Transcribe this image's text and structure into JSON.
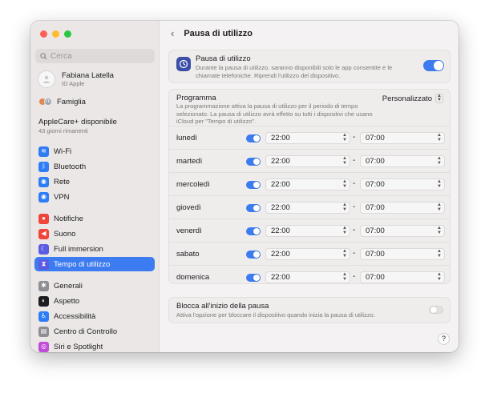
{
  "search": {
    "placeholder": "Cerca"
  },
  "profile": {
    "name": "Fabiana Latella",
    "subtitle": "ID Apple"
  },
  "family": {
    "label": "Famiglia"
  },
  "applecare": {
    "title": "AppleCare+ disponibile",
    "subtitle": "43 giorni rimanenti"
  },
  "sidebar": {
    "items": [
      {
        "label": "Wi-Fi",
        "icon": "wifi-icon",
        "color": "#2f7df6",
        "active": false
      },
      {
        "label": "Bluetooth",
        "icon": "bluetooth-icon",
        "color": "#2f7df6",
        "active": false
      },
      {
        "label": "Rete",
        "icon": "globe-icon",
        "color": "#2f7df6",
        "active": false
      },
      {
        "label": "VPN",
        "icon": "vpn-globe-icon",
        "color": "#2f7df6",
        "active": false
      },
      {
        "label": "Notifiche",
        "icon": "bell-icon",
        "color": "#f0453a",
        "active": false
      },
      {
        "label": "Suono",
        "icon": "speaker-icon",
        "color": "#f0453a",
        "active": false
      },
      {
        "label": "Full immersion",
        "icon": "moon-icon",
        "color": "#5b5ce2",
        "active": false
      },
      {
        "label": "Tempo di utilizzo",
        "icon": "hourglass-icon",
        "color": "#5b5ce2",
        "active": true
      },
      {
        "label": "Generali",
        "icon": "gear-icon",
        "color": "#8e8e93",
        "active": false
      },
      {
        "label": "Aspetto",
        "icon": "appearance-icon",
        "color": "#1d1d1f",
        "active": false
      },
      {
        "label": "Accessibilità",
        "icon": "accessibility-icon",
        "color": "#2f7df6",
        "active": false
      },
      {
        "label": "Centro di Controllo",
        "icon": "control-center-icon",
        "color": "#8e8e93",
        "active": false
      },
      {
        "label": "Siri e Spotlight",
        "icon": "siri-icon",
        "color": "#c04bd6",
        "active": false
      }
    ]
  },
  "header": {
    "title": "Pausa di utilizzo"
  },
  "downtime": {
    "title": "Pausa di utilizzo",
    "description": "Durante la pausa di utilizzo, saranno disponibili solo le app consentite e le chiamate telefoniche. Riprendi l'utilizzo del dispositivo.",
    "enabled": true
  },
  "schedule": {
    "title": "Programma",
    "description": "La programmazione attiva la pausa di utilizzo per il periodo di tempo selezionato. La pausa di utilizzo avrà effetto su tutti i dispositivi che usano iCloud per \"Tempo di utilizzo\".",
    "mode": "Personalizzato",
    "separator": "-",
    "days": [
      {
        "name": "lunedì",
        "enabled": true,
        "start": "22:00",
        "end": "07:00"
      },
      {
        "name": "martedì",
        "enabled": true,
        "start": "22:00",
        "end": "07:00"
      },
      {
        "name": "mercoledì",
        "enabled": true,
        "start": "22:00",
        "end": "07:00"
      },
      {
        "name": "giovedì",
        "enabled": true,
        "start": "22:00",
        "end": "07:00"
      },
      {
        "name": "venerdì",
        "enabled": true,
        "start": "22:00",
        "end": "07:00"
      },
      {
        "name": "sabato",
        "enabled": true,
        "start": "22:00",
        "end": "07:00"
      },
      {
        "name": "domenica",
        "enabled": true,
        "start": "22:00",
        "end": "07:00"
      }
    ]
  },
  "block": {
    "title": "Blocca all'inizio della pausa",
    "description": "Attiva l'opzione per bloccare il dispositivo quando inizia la pausa di utilizzo.",
    "enabled": false
  },
  "help": {
    "label": "?"
  },
  "colors": {
    "accent": "#3d7bf0"
  }
}
